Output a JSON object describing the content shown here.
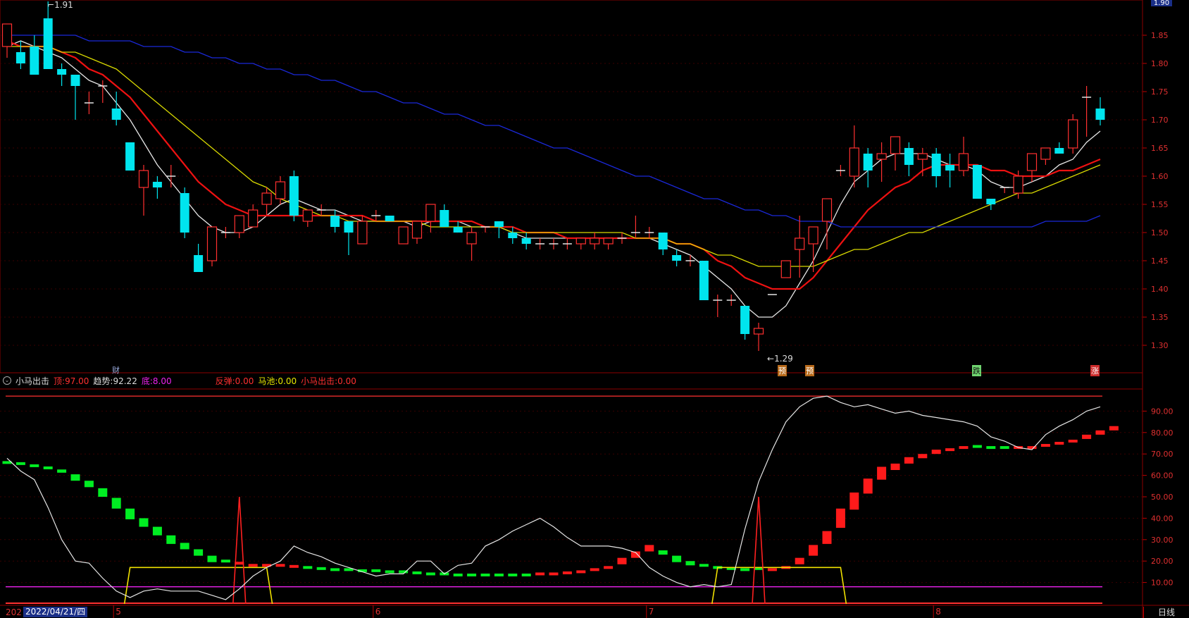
{
  "price_panel": {
    "y_ticks": [
      "1.85",
      "1.80",
      "1.75",
      "1.70",
      "1.65",
      "1.60",
      "1.55",
      "1.50",
      "1.45",
      "1.40",
      "1.35",
      "1.30"
    ],
    "current_price_label": "1.90",
    "high_marker": "1.91",
    "low_marker": "1.29",
    "event_labels": [
      "财",
      "预",
      "预",
      "跌",
      "涨"
    ],
    "colors": {
      "up": "#ff3030",
      "down": "#00e5ee",
      "ma_white": "#e6e6e6",
      "ma_red": "#ee1111",
      "ma_yellow": "#d8d800",
      "ma_blue": "#1a28d8"
    }
  },
  "indicator_panel": {
    "title": "小马出击",
    "params": [
      {
        "key": "顶:",
        "value": "97.00",
        "color": "#ff3030"
      },
      {
        "key": "趋势:",
        "value": "92.22",
        "color": "#dddddd"
      },
      {
        "key": "底:",
        "value": "8.00",
        "color": "#ee22ee"
      },
      {
        "key": "反弹:",
        "value": "0.00",
        "color": "#ff3030"
      },
      {
        "key": "马池:",
        "value": "0.00",
        "color": "#e8e800"
      },
      {
        "key": "小马出击:",
        "value": "0.00",
        "color": "#ff3030"
      }
    ],
    "y_ticks": [
      "90.00",
      "80.00",
      "70.00",
      "60.00",
      "50.00",
      "40.00",
      "30.00",
      "20.00",
      "10.00"
    ]
  },
  "x_axis": {
    "date_box": "2022/04/21/四",
    "date_box_prefix": "202",
    "month_labels": [
      "5",
      "6",
      "7",
      "8"
    ],
    "period": "日线"
  },
  "chart_data": [
    {
      "type": "candlestick",
      "title": "",
      "ylim": [
        1.26,
        1.9
      ],
      "candles_ohlc": [
        [
          1.83,
          1.87,
          1.81,
          1.87
        ],
        [
          1.82,
          1.84,
          1.79,
          1.8
        ],
        [
          1.83,
          1.85,
          1.78,
          1.78
        ],
        [
          1.88,
          1.91,
          1.79,
          1.79
        ],
        [
          1.79,
          1.8,
          1.76,
          1.78
        ],
        [
          1.78,
          1.78,
          1.7,
          1.76
        ],
        [
          1.73,
          1.75,
          1.71,
          1.73
        ],
        [
          1.76,
          1.77,
          1.73,
          1.76
        ],
        [
          1.72,
          1.75,
          1.69,
          1.7
        ],
        [
          1.66,
          1.66,
          1.61,
          1.61
        ],
        [
          1.58,
          1.62,
          1.53,
          1.61
        ],
        [
          1.59,
          1.6,
          1.56,
          1.58
        ],
        [
          1.6,
          1.62,
          1.58,
          1.6
        ],
        [
          1.57,
          1.58,
          1.49,
          1.5
        ],
        [
          1.46,
          1.48,
          1.43,
          1.43
        ],
        [
          1.45,
          1.51,
          1.44,
          1.51
        ],
        [
          1.5,
          1.51,
          1.49,
          1.5
        ],
        [
          1.5,
          1.53,
          1.49,
          1.53
        ],
        [
          1.51,
          1.55,
          1.51,
          1.54
        ],
        [
          1.55,
          1.58,
          1.53,
          1.57
        ],
        [
          1.56,
          1.6,
          1.55,
          1.59
        ],
        [
          1.6,
          1.61,
          1.52,
          1.53
        ],
        [
          1.52,
          1.54,
          1.51,
          1.54
        ],
        [
          1.54,
          1.55,
          1.53,
          1.54
        ],
        [
          1.53,
          1.54,
          1.5,
          1.51
        ],
        [
          1.52,
          1.52,
          1.46,
          1.5
        ],
        [
          1.48,
          1.53,
          1.48,
          1.52
        ],
        [
          1.53,
          1.54,
          1.52,
          1.53
        ],
        [
          1.53,
          1.53,
          1.52,
          1.52
        ],
        [
          1.48,
          1.51,
          1.48,
          1.51
        ],
        [
          1.49,
          1.52,
          1.48,
          1.52
        ],
        [
          1.52,
          1.55,
          1.5,
          1.55
        ],
        [
          1.54,
          1.55,
          1.51,
          1.51
        ],
        [
          1.51,
          1.52,
          1.5,
          1.5
        ],
        [
          1.48,
          1.51,
          1.45,
          1.5
        ],
        [
          1.51,
          1.51,
          1.5,
          1.51
        ],
        [
          1.52,
          1.52,
          1.49,
          1.51
        ],
        [
          1.5,
          1.51,
          1.48,
          1.49
        ],
        [
          1.49,
          1.5,
          1.47,
          1.48
        ],
        [
          1.48,
          1.49,
          1.47,
          1.48
        ],
        [
          1.48,
          1.49,
          1.47,
          1.48
        ],
        [
          1.48,
          1.49,
          1.47,
          1.48
        ],
        [
          1.48,
          1.49,
          1.47,
          1.49
        ],
        [
          1.48,
          1.5,
          1.47,
          1.49
        ],
        [
          1.48,
          1.49,
          1.47,
          1.49
        ],
        [
          1.49,
          1.5,
          1.48,
          1.49
        ],
        [
          1.5,
          1.53,
          1.49,
          1.5
        ],
        [
          1.5,
          1.51,
          1.49,
          1.5
        ],
        [
          1.5,
          1.5,
          1.46,
          1.47
        ],
        [
          1.46,
          1.47,
          1.44,
          1.45
        ],
        [
          1.45,
          1.46,
          1.44,
          1.45
        ],
        [
          1.45,
          1.45,
          1.38,
          1.38
        ],
        [
          1.38,
          1.39,
          1.35,
          1.38
        ],
        [
          1.38,
          1.39,
          1.37,
          1.38
        ],
        [
          1.37,
          1.37,
          1.31,
          1.32
        ],
        [
          1.32,
          1.34,
          1.29,
          1.33
        ],
        [
          1.39,
          1.39,
          1.39,
          1.39
        ],
        [
          1.42,
          1.45,
          1.42,
          1.45
        ],
        [
          1.47,
          1.53,
          1.42,
          1.49
        ],
        [
          1.48,
          1.51,
          1.43,
          1.51
        ],
        [
          1.52,
          1.56,
          1.47,
          1.56
        ],
        [
          1.61,
          1.62,
          1.6,
          1.61
        ],
        [
          1.6,
          1.69,
          1.58,
          1.65
        ],
        [
          1.64,
          1.65,
          1.58,
          1.61
        ],
        [
          1.63,
          1.66,
          1.59,
          1.64
        ],
        [
          1.64,
          1.67,
          1.61,
          1.67
        ],
        [
          1.65,
          1.66,
          1.6,
          1.62
        ],
        [
          1.63,
          1.65,
          1.6,
          1.64
        ],
        [
          1.64,
          1.65,
          1.58,
          1.6
        ],
        [
          1.62,
          1.64,
          1.58,
          1.61
        ],
        [
          1.61,
          1.67,
          1.6,
          1.64
        ],
        [
          1.62,
          1.62,
          1.56,
          1.56
        ],
        [
          1.56,
          1.56,
          1.54,
          1.55
        ],
        [
          1.58,
          1.58,
          1.57,
          1.58
        ],
        [
          1.57,
          1.61,
          1.56,
          1.6
        ],
        [
          1.61,
          1.64,
          1.59,
          1.64
        ],
        [
          1.63,
          1.65,
          1.62,
          1.65
        ],
        [
          1.65,
          1.66,
          1.64,
          1.64
        ],
        [
          1.65,
          1.71,
          1.64,
          1.7
        ],
        [
          1.74,
          1.76,
          1.67,
          1.74
        ],
        [
          1.72,
          1.74,
          1.69,
          1.7
        ]
      ],
      "series": [
        {
          "name": "",
          "color": "#e6e6e6",
          "values": [
            1.83,
            1.84,
            1.83,
            1.82,
            1.81,
            1.79,
            1.77,
            1.76,
            1.73,
            1.7,
            1.66,
            1.62,
            1.59,
            1.56,
            1.53,
            1.51,
            1.5,
            1.5,
            1.51,
            1.53,
            1.55,
            1.56,
            1.55,
            1.54,
            1.54,
            1.53,
            1.52,
            1.52,
            1.52,
            1.52,
            1.51,
            1.52,
            1.52,
            1.52,
            1.51,
            1.51,
            1.51,
            1.5,
            1.49,
            1.49,
            1.49,
            1.49,
            1.49,
            1.49,
            1.49,
            1.49,
            1.49,
            1.49,
            1.48,
            1.47,
            1.46,
            1.44,
            1.42,
            1.4,
            1.37,
            1.35,
            1.35,
            1.37,
            1.41,
            1.45,
            1.5,
            1.55,
            1.59,
            1.61,
            1.63,
            1.64,
            1.64,
            1.64,
            1.63,
            1.62,
            1.62,
            1.61,
            1.59,
            1.58,
            1.58,
            1.59,
            1.6,
            1.62,
            1.63,
            1.66,
            1.68
          ]
        },
        {
          "name": "",
          "color": "#ee1111",
          "values": [
            1.84,
            1.83,
            1.83,
            1.83,
            1.82,
            1.81,
            1.79,
            1.78,
            1.76,
            1.74,
            1.71,
            1.68,
            1.65,
            1.62,
            1.59,
            1.57,
            1.55,
            1.54,
            1.53,
            1.53,
            1.53,
            1.53,
            1.53,
            1.53,
            1.53,
            1.53,
            1.53,
            1.52,
            1.52,
            1.52,
            1.52,
            1.52,
            1.52,
            1.52,
            1.52,
            1.51,
            1.51,
            1.51,
            1.5,
            1.5,
            1.5,
            1.49,
            1.49,
            1.49,
            1.49,
            1.49,
            1.49,
            1.49,
            1.49,
            1.48,
            1.48,
            1.47,
            1.45,
            1.44,
            1.42,
            1.41,
            1.4,
            1.4,
            1.4,
            1.42,
            1.45,
            1.48,
            1.51,
            1.54,
            1.56,
            1.58,
            1.59,
            1.61,
            1.62,
            1.62,
            1.62,
            1.62,
            1.61,
            1.61,
            1.6,
            1.6,
            1.6,
            1.61,
            1.61,
            1.62,
            1.63
          ]
        },
        {
          "name": "",
          "color": "#d8d800",
          "values": [
            1.83,
            1.83,
            1.83,
            1.83,
            1.82,
            1.82,
            1.81,
            1.8,
            1.79,
            1.77,
            1.75,
            1.73,
            1.71,
            1.69,
            1.67,
            1.65,
            1.63,
            1.61,
            1.59,
            1.58,
            1.56,
            1.55,
            1.54,
            1.53,
            1.53,
            1.52,
            1.52,
            1.52,
            1.52,
            1.52,
            1.52,
            1.51,
            1.51,
            1.51,
            1.51,
            1.51,
            1.51,
            1.5,
            1.5,
            1.5,
            1.5,
            1.5,
            1.5,
            1.5,
            1.5,
            1.5,
            1.49,
            1.49,
            1.49,
            1.48,
            1.48,
            1.47,
            1.46,
            1.46,
            1.45,
            1.44,
            1.44,
            1.44,
            1.44,
            1.44,
            1.45,
            1.46,
            1.47,
            1.47,
            1.48,
            1.49,
            1.5,
            1.5,
            1.51,
            1.52,
            1.53,
            1.54,
            1.55,
            1.56,
            1.57,
            1.57,
            1.58,
            1.59,
            1.6,
            1.61,
            1.62
          ]
        },
        {
          "name": "",
          "color": "#1a28d8",
          "values": [
            1.85,
            1.85,
            1.85,
            1.85,
            1.85,
            1.85,
            1.84,
            1.84,
            1.84,
            1.84,
            1.83,
            1.83,
            1.83,
            1.82,
            1.82,
            1.81,
            1.81,
            1.8,
            1.8,
            1.79,
            1.79,
            1.78,
            1.78,
            1.77,
            1.77,
            1.76,
            1.75,
            1.75,
            1.74,
            1.73,
            1.73,
            1.72,
            1.71,
            1.71,
            1.7,
            1.69,
            1.69,
            1.68,
            1.67,
            1.66,
            1.65,
            1.65,
            1.64,
            1.63,
            1.62,
            1.61,
            1.6,
            1.6,
            1.59,
            1.58,
            1.57,
            1.56,
            1.56,
            1.55,
            1.54,
            1.54,
            1.53,
            1.53,
            1.52,
            1.52,
            1.52,
            1.51,
            1.51,
            1.51,
            1.51,
            1.51,
            1.51,
            1.51,
            1.51,
            1.51,
            1.51,
            1.51,
            1.51,
            1.51,
            1.51,
            1.51,
            1.52,
            1.52,
            1.52,
            1.52,
            1.53
          ]
        }
      ]
    },
    {
      "type": "bar+line",
      "title": "小马出击",
      "ylim": [
        0,
        100
      ],
      "horizontal_lines": [
        {
          "name": "顶",
          "value": 97,
          "color": "#ff3030"
        },
        {
          "name": "底",
          "value": 8,
          "color": "#ee22ee"
        }
      ],
      "trend_blocks": [
        66,
        65.5,
        64.5,
        63.5,
        62,
        59,
        56,
        52,
        47,
        42,
        38,
        34,
        30,
        27,
        24,
        21,
        20,
        19,
        18,
        18,
        18,
        17.5,
        17,
        16.5,
        16,
        16,
        15.5,
        15.5,
        15,
        15,
        14.5,
        14,
        14,
        13.5,
        13.5,
        13.5,
        13.5,
        13.5,
        13.5,
        14,
        14,
        14.5,
        15,
        16,
        17,
        20,
        23,
        26,
        24,
        21,
        19,
        18,
        17,
        16.5,
        16,
        16.5,
        16,
        17,
        20,
        25,
        31,
        40,
        48,
        55,
        61,
        64,
        67,
        69,
        71,
        72,
        73,
        73.5,
        73,
        73,
        73,
        73,
        74,
        75,
        76,
        78,
        80,
        82
      ],
      "trend_block_colors": [
        "g",
        "g",
        "g",
        "g",
        "g",
        "g",
        "g",
        "g",
        "g",
        "g",
        "g",
        "g",
        "g",
        "g",
        "g",
        "g",
        "g",
        "r",
        "r",
        "r",
        "r",
        "r",
        "g",
        "g",
        "g",
        "g",
        "g",
        "g",
        "g",
        "g",
        "g",
        "g",
        "g",
        "g",
        "g",
        "g",
        "g",
        "g",
        "g",
        "r",
        "r",
        "r",
        "r",
        "r",
        "r",
        "r",
        "r",
        "r",
        "g",
        "g",
        "g",
        "g",
        "g",
        "g",
        "g",
        "g",
        "r",
        "r",
        "r",
        "r",
        "r",
        "r",
        "r",
        "r",
        "r",
        "r",
        "r",
        "r",
        "r",
        "r",
        "r",
        "g",
        "g",
        "g",
        "r",
        "r",
        "r",
        "r",
        "r",
        "r",
        "r"
      ],
      "trend_line": [
        68,
        62,
        58,
        45,
        30,
        20,
        19,
        12,
        6,
        3,
        6,
        7,
        6,
        6,
        6,
        4,
        2,
        7,
        13,
        17,
        20,
        27,
        24,
        22,
        19,
        17,
        15,
        13,
        14,
        14,
        20,
        20,
        14,
        18,
        19,
        27,
        30,
        34,
        37,
        40,
        36,
        31,
        27,
        27,
        27,
        26,
        24,
        17,
        13,
        10,
        8,
        9,
        8,
        9,
        35,
        57,
        72,
        85,
        92,
        96,
        97,
        94,
        92,
        93,
        91,
        89,
        90,
        88,
        87,
        86,
        85,
        83,
        78,
        76,
        73,
        72,
        79,
        83,
        86,
        90,
        92
      ],
      "rebound_spikes": [
        {
          "index": 17,
          "value": 50
        },
        {
          "index": 55,
          "value": 50
        }
      ],
      "pool_plateaus": [
        {
          "from_index": 9,
          "to_index": 19,
          "value": 17
        },
        {
          "from_index": 52,
          "to_index": 61,
          "value": 17
        }
      ]
    }
  ]
}
